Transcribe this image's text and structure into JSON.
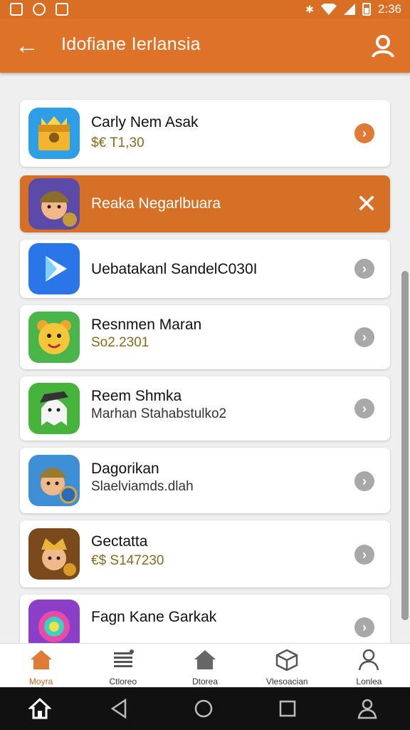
{
  "statusbar": {
    "time": "2:36"
  },
  "appbar": {
    "title": "Idofiane Ierlansia"
  },
  "items": [
    {
      "name": "Carly Nem Asak",
      "sub": "$€ T1,30",
      "thumb": "gold-crate-icon",
      "action": "chevron-icon"
    },
    {
      "name": "Reaka  Negarlbuara",
      "sub": "",
      "thumb": "warrior-avatar-icon",
      "action": "close-icon"
    },
    {
      "name": "Uebatakanl SandelC030I",
      "sub": "",
      "thumb": "play-store-icon",
      "action": "chevron-icon"
    },
    {
      "name": "Resnmen Maran",
      "sub": "So2.2301",
      "thumb": "cartoon-bear-icon",
      "action": "chevron-icon"
    },
    {
      "name": "Reem Shmka",
      "sub": "Marhan Stahabstulko2",
      "thumb": "ghost-character-icon",
      "action": "chevron-icon"
    },
    {
      "name": "Dagorikan",
      "sub": "Slaelviamds.dlah",
      "thumb": "knight-avatar-icon",
      "action": "chevron-icon"
    },
    {
      "name": "Gectatta",
      "sub": "€$ S147230",
      "thumb": "crowned-hero-icon",
      "action": "chevron-icon"
    },
    {
      "name": "Fagn Kane Garkak",
      "sub": "",
      "thumb": "colorful-orb-icon",
      "action": "chevron-icon"
    }
  ],
  "tabs": [
    {
      "label": "Moyra",
      "icon": "home-icon",
      "active": true
    },
    {
      "label": "Ctloreo",
      "icon": "list-icon",
      "active": false
    },
    {
      "label": "Dtorea",
      "icon": "house-icon",
      "active": false
    },
    {
      "label": "Vlesoacian",
      "icon": "cube-icon",
      "active": false
    },
    {
      "label": "Lonlea",
      "icon": "person-icon",
      "active": false
    }
  ],
  "colors": {
    "accent": "#dd7228",
    "highlight": "#d77027",
    "navbar": "#111111"
  }
}
